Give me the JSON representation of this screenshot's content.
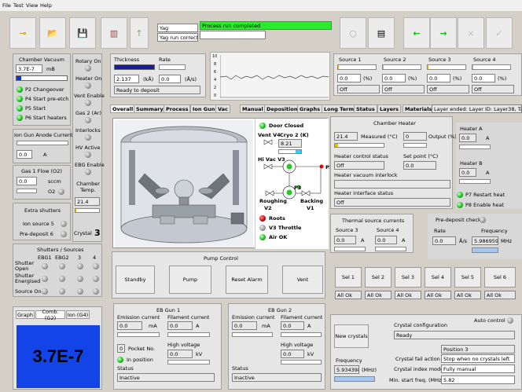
{
  "menu": [
    "File",
    "Test",
    "View",
    "Help"
  ],
  "toolbar": {
    "yag": "Yag",
    "yag_run": "Yag run correct",
    "status": "Process run completed"
  },
  "vac": {
    "title": "Chamber Vacuum",
    "value": "3.7E-7",
    "unit": "mB",
    "p2": "P2 Changeover",
    "p4": "P4 Start pre-etch",
    "p5": "P5 Start",
    "p6": "P6 Start heaters"
  },
  "rot": {
    "rotary": "Rotary On",
    "heater": "Heater On",
    "vent": "Vent Enable",
    "gas2": "Gas 2 (Ar)",
    "interlocks": "Interlocks",
    "hv": "HV Active",
    "ebg": "EBG Enable",
    "ctemp": "Chamber Temp.",
    "ctemp_val": "21.4",
    "crystal": "Crystal",
    "crystal_num": "3"
  },
  "anode": {
    "title": "Ion Gun Anode Current",
    "value": "0.0",
    "unit": "A"
  },
  "gas1": {
    "title": "Gas 1 Flow (O2)",
    "value": "0.0",
    "unit": "sccm",
    "o2": "O2"
  },
  "extra": {
    "title": "Extra shutters",
    "ion5": "Ion source 5",
    "pre6": "Pre-deposit 6"
  },
  "shut": {
    "title": "Shutters / Sources",
    "cols": [
      "EBG1",
      "EBG2",
      "3",
      "4"
    ],
    "rows": [
      "Shutter Open",
      "Shutter Energised",
      "Source On"
    ]
  },
  "bottomtabs": [
    "Graph",
    "Comb. (G2)",
    "Ion (G4)"
  ],
  "bigvac": "3.7E-7",
  "thick": {
    "t": "Thickness",
    "r": "Rate",
    "tv": "2.137",
    "tu": "(kÅ)",
    "rv": "0.0",
    "ru": "(Å/s)",
    "ready": "Ready to deposit"
  },
  "graph": {
    "yt": [
      "10",
      "8",
      "6",
      "4",
      "2",
      "0"
    ]
  },
  "sources": [
    {
      "n": "Source 1",
      "v": "0.0",
      "s": "Off"
    },
    {
      "n": "Source 2",
      "v": "0.0",
      "s": "Off"
    },
    {
      "n": "Source 3",
      "v": "0.0",
      "s": "Off"
    },
    {
      "n": "Source 4",
      "v": "0.0",
      "s": "Off"
    }
  ],
  "pct": "(%)",
  "tabs": [
    "Overall",
    "Summary",
    "Process",
    "Ion Gun",
    "Vac",
    "Manual",
    "Deposition",
    "Graphs",
    "Long Term",
    "Status",
    "Layers",
    "Materials"
  ],
  "layer": "Layer ended: Layer ID: Layer38, Targ",
  "chm": {
    "door": "Door Closed",
    "vv4": "Vent V4",
    "cryo": "Cryo 2 (K)",
    "cryo_v": "8.21",
    "hv3": "Hi Vac V3",
    "p1": "P1",
    "p3": "P3",
    "rough": "Roughing",
    "v2": "V2",
    "back": "Backing",
    "v1": "V1",
    "roots": "Roots",
    "v3t": "V3 Throttle",
    "air": "Air OK"
  },
  "heater": {
    "title": "Chamber Heater",
    "mv": "21.4",
    "mu": "Measured (°C)",
    "ov": "0",
    "ou": "Output (%)",
    "ctl": "Heater control status",
    "ctlv": "Off",
    "sp": "Set point (°C)",
    "spv": "0.0",
    "vi": "Heater vacuum interlock",
    "iface": "Heater interface status",
    "ifacev": "Off",
    "ha": "Heater A",
    "hav": "0.0",
    "hb": "Heater B",
    "hbv": "0.0",
    "p7": "P7 Restart heat",
    "p8": "P8 Enable heat",
    "unit": "A"
  },
  "therm": {
    "title": "Thermal source currents",
    "s3": "Source 3",
    "s4": "Source 4",
    "v3": "0.0",
    "v4": "0.0",
    "unit": "A"
  },
  "predep": {
    "title": "Pre-deposit check",
    "rate": "Rate",
    "freq": "Frequency",
    "rv": "0.0",
    "ru": "Å/s",
    "fv": "5.986959",
    "fu": "MHz"
  },
  "pump": {
    "title": "Pump Control",
    "b": [
      "Standby",
      "Pump",
      "Reset Alarm",
      "Vent"
    ]
  },
  "sel": {
    "b": [
      "Sel 1",
      "Sel 2",
      "Sel 3",
      "Sel 4",
      "Sel 5",
      "Sel 6"
    ],
    "ok": "All Ok"
  },
  "eb1": {
    "title": "EB Gun 1",
    "em": "Emission current",
    "fc": "Filament current",
    "ev": "0.0",
    "eu": "mA",
    "fv": "0.0",
    "fu": "A",
    "pv": "0",
    "pl": "Pocket No.",
    "hv": "High voltage",
    "hvv": "0.0",
    "hvu": "kV",
    "inpos": "In position",
    "st": "Status",
    "stv": "Inactive"
  },
  "eb2": {
    "title": "EB Gun 2",
    "em": "Emission current",
    "fc": "Filament current",
    "ev": "0.0",
    "eu": "mA",
    "fv": "0.0",
    "fu": "A",
    "hv": "High voltage",
    "hvv": "0.0",
    "hvu": "kV",
    "st": "Status",
    "stv": "Inactive"
  },
  "crys": {
    "newc": "New crystals",
    "cfg": "Crystal configuration",
    "auto": "Auto control",
    "ready": "Ready",
    "pos": "Position 3",
    "freq": "Frequency",
    "fv": "5.934398",
    "fu": "(MHz)",
    "fail": "Crystal fail action",
    "failv": "Stop when no crystals left",
    "idx": "Crystal index mode",
    "idxv": "Fully manual",
    "min": "Min. start freq. (MHz)",
    "minv": "5.82"
  }
}
